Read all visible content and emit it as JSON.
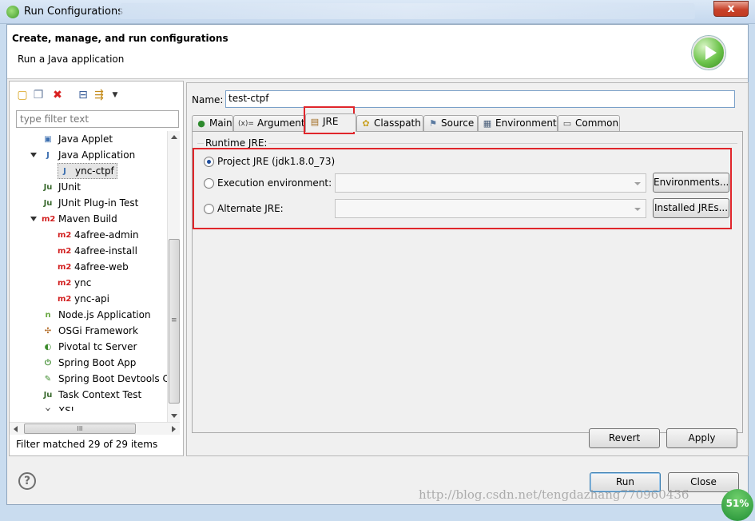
{
  "window": {
    "title": "Run Configurations",
    "close_label": "x"
  },
  "header": {
    "title": "Create, manage, and run configurations",
    "subtitle": "Run a Java application"
  },
  "filter": {
    "placeholder": "type filter text"
  },
  "tree": {
    "items": [
      {
        "label": "Java Applet",
        "icon": "java-applet-icon",
        "glyph": "▣",
        "color": "#3c6fb0"
      },
      {
        "label": "Java Application",
        "icon": "java-application-icon",
        "glyph": "J",
        "color": "#3c6fb0"
      },
      {
        "label": "ync-ctpf",
        "icon": "java-launch-icon",
        "glyph": "J",
        "color": "#3c6fb0"
      },
      {
        "label": "JUnit",
        "icon": "junit-icon",
        "glyph": "Ju",
        "color": "#3a6a2e"
      },
      {
        "label": "JUnit Plug-in Test",
        "icon": "junit-plugin-icon",
        "glyph": "Ju",
        "color": "#3a6a2e"
      },
      {
        "label": "Maven Build",
        "icon": "maven-icon",
        "glyph": "m2",
        "color": "#d21f1f"
      },
      {
        "label": "4afree-admin",
        "icon": "maven-launch-icon",
        "glyph": "m2",
        "color": "#d21f1f"
      },
      {
        "label": "4afree-install",
        "icon": "maven-launch-icon",
        "glyph": "m2",
        "color": "#d21f1f"
      },
      {
        "label": "4afree-web",
        "icon": "maven-launch-icon",
        "glyph": "m2",
        "color": "#d21f1f"
      },
      {
        "label": "ync",
        "icon": "maven-launch-icon",
        "glyph": "m2",
        "color": "#d21f1f"
      },
      {
        "label": "ync-api",
        "icon": "maven-launch-icon",
        "glyph": "m2",
        "color": "#d21f1f"
      },
      {
        "label": "Node.js Application",
        "icon": "nodejs-icon",
        "glyph": "n",
        "color": "#6aa843"
      },
      {
        "label": "OSGi Framework",
        "icon": "osgi-icon",
        "glyph": "✣",
        "color": "#b0661e"
      },
      {
        "label": "Pivotal tc Server",
        "icon": "pivotal-icon",
        "glyph": "◐",
        "color": "#3d8b2d"
      },
      {
        "label": "Spring Boot App",
        "icon": "spring-boot-icon",
        "glyph": "⏻",
        "color": "#3d8b2d"
      },
      {
        "label": "Spring Boot Devtools Cli",
        "icon": "spring-devtools-icon",
        "glyph": "✎",
        "color": "#3d8b2d"
      },
      {
        "label": "Task Context Test",
        "icon": "task-context-icon",
        "glyph": "Ju",
        "color": "#3a6a2e"
      },
      {
        "label": "XSL",
        "icon": "xsl-icon",
        "glyph": "✕",
        "color": "#555555"
      }
    ]
  },
  "filter_status": "Filter matched 29 of 29 items",
  "scroll_arrows": {
    "horizontal_thumb": "III",
    "vertical_thumb": "≡"
  },
  "config": {
    "name_label": "Name:",
    "name_value": "test-ctpf",
    "tabs": [
      {
        "label": "Main",
        "icon": "main-tab-icon",
        "glyph": "●"
      },
      {
        "label": "Arguments",
        "icon": "arguments-tab-icon",
        "glyph": "(x)="
      },
      {
        "label": "JRE",
        "icon": "jre-tab-icon",
        "glyph": "▤"
      },
      {
        "label": "Classpath",
        "icon": "classpath-tab-icon",
        "glyph": "✿"
      },
      {
        "label": "Source",
        "icon": "source-tab-icon",
        "glyph": "⚑"
      },
      {
        "label": "Environment",
        "icon": "environment-tab-icon",
        "glyph": "▦"
      },
      {
        "label": "Common",
        "icon": "common-tab-icon",
        "glyph": "▭"
      }
    ],
    "active_tab": "JRE",
    "runtime_jre_label": "Runtime JRE:",
    "options": {
      "project_jre": "Project JRE (jdk1.8.0_73)",
      "execution_env": "Execution environment:",
      "alternate_jre": "Alternate JRE:"
    },
    "environments_button": "Environments...",
    "installed_jres_button": "Installed JREs..."
  },
  "actions": {
    "revert": "Revert",
    "apply": "Apply",
    "run": "Run",
    "close": "Close"
  },
  "help_glyph": "?",
  "watermark": "http://blog.csdn.net/tengdazhang770960436",
  "cpu_badge": "51%",
  "colors": {
    "highlight": "#e0262b",
    "accent": "#3c7fb1"
  }
}
